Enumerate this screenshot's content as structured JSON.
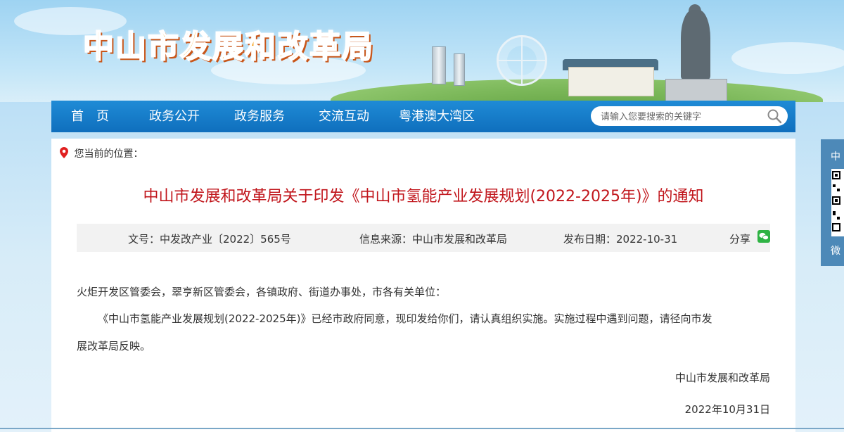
{
  "site": {
    "title": "中山市发展和改革局"
  },
  "nav": {
    "items": [
      "首　页",
      "政务公开",
      "政务服务",
      "交流互动",
      "粤港澳大湾区"
    ],
    "search_placeholder": "请输入您要搜索的关键字"
  },
  "location": {
    "label": "您当前的位置："
  },
  "article": {
    "title": "中山市发展和改革局关于印发《中山市氢能产业发展规划(2022-2025年)》的通知",
    "doc_no": "文号：中发改产业〔2022〕565号",
    "source": "信息来源：中山市发展和改革局",
    "date": "发布日期：2022-10-31",
    "share": "分享",
    "addressee": "火炬开发区管委会，翠亨新区管委会，各镇政府、街道办事处，市各有关单位：",
    "para1_line1": "《中山市氢能产业发展规划(2022-2025年)》已经市政府同意，现印发给你们，请认真组织实施。实施过程中遇到问题，请径向市发",
    "para1_line2": "展改革局反映。",
    "signature": "中山市发展和改革局",
    "sign_date": "2022年10月31日"
  },
  "side": {
    "top": "中",
    "bottom": "微"
  },
  "colors": {
    "nav": "#0f6fbd",
    "title_red": "#c1161c",
    "accent_orange": "#f6a21a"
  }
}
